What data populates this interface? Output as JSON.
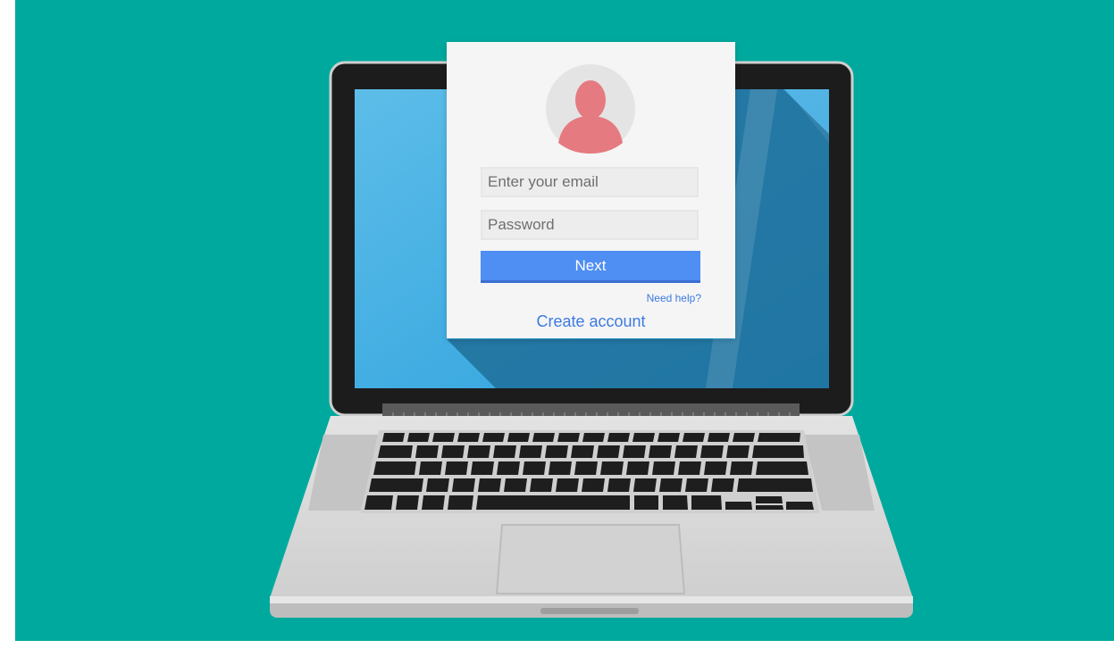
{
  "login": {
    "email_placeholder": "Enter your email",
    "password_placeholder": "Password",
    "next_label": "Next",
    "need_help_label": "Need help?",
    "create_account_label": "Create account",
    "avatar_icon": "user-silhouette-icon"
  },
  "colors": {
    "background": "#00a99d",
    "screen": "#2fa3dd",
    "button": "#4f8ef2",
    "link": "#3d7ae0",
    "avatar_figure": "#e57a80",
    "laptop_body": "#d9d9d9"
  }
}
